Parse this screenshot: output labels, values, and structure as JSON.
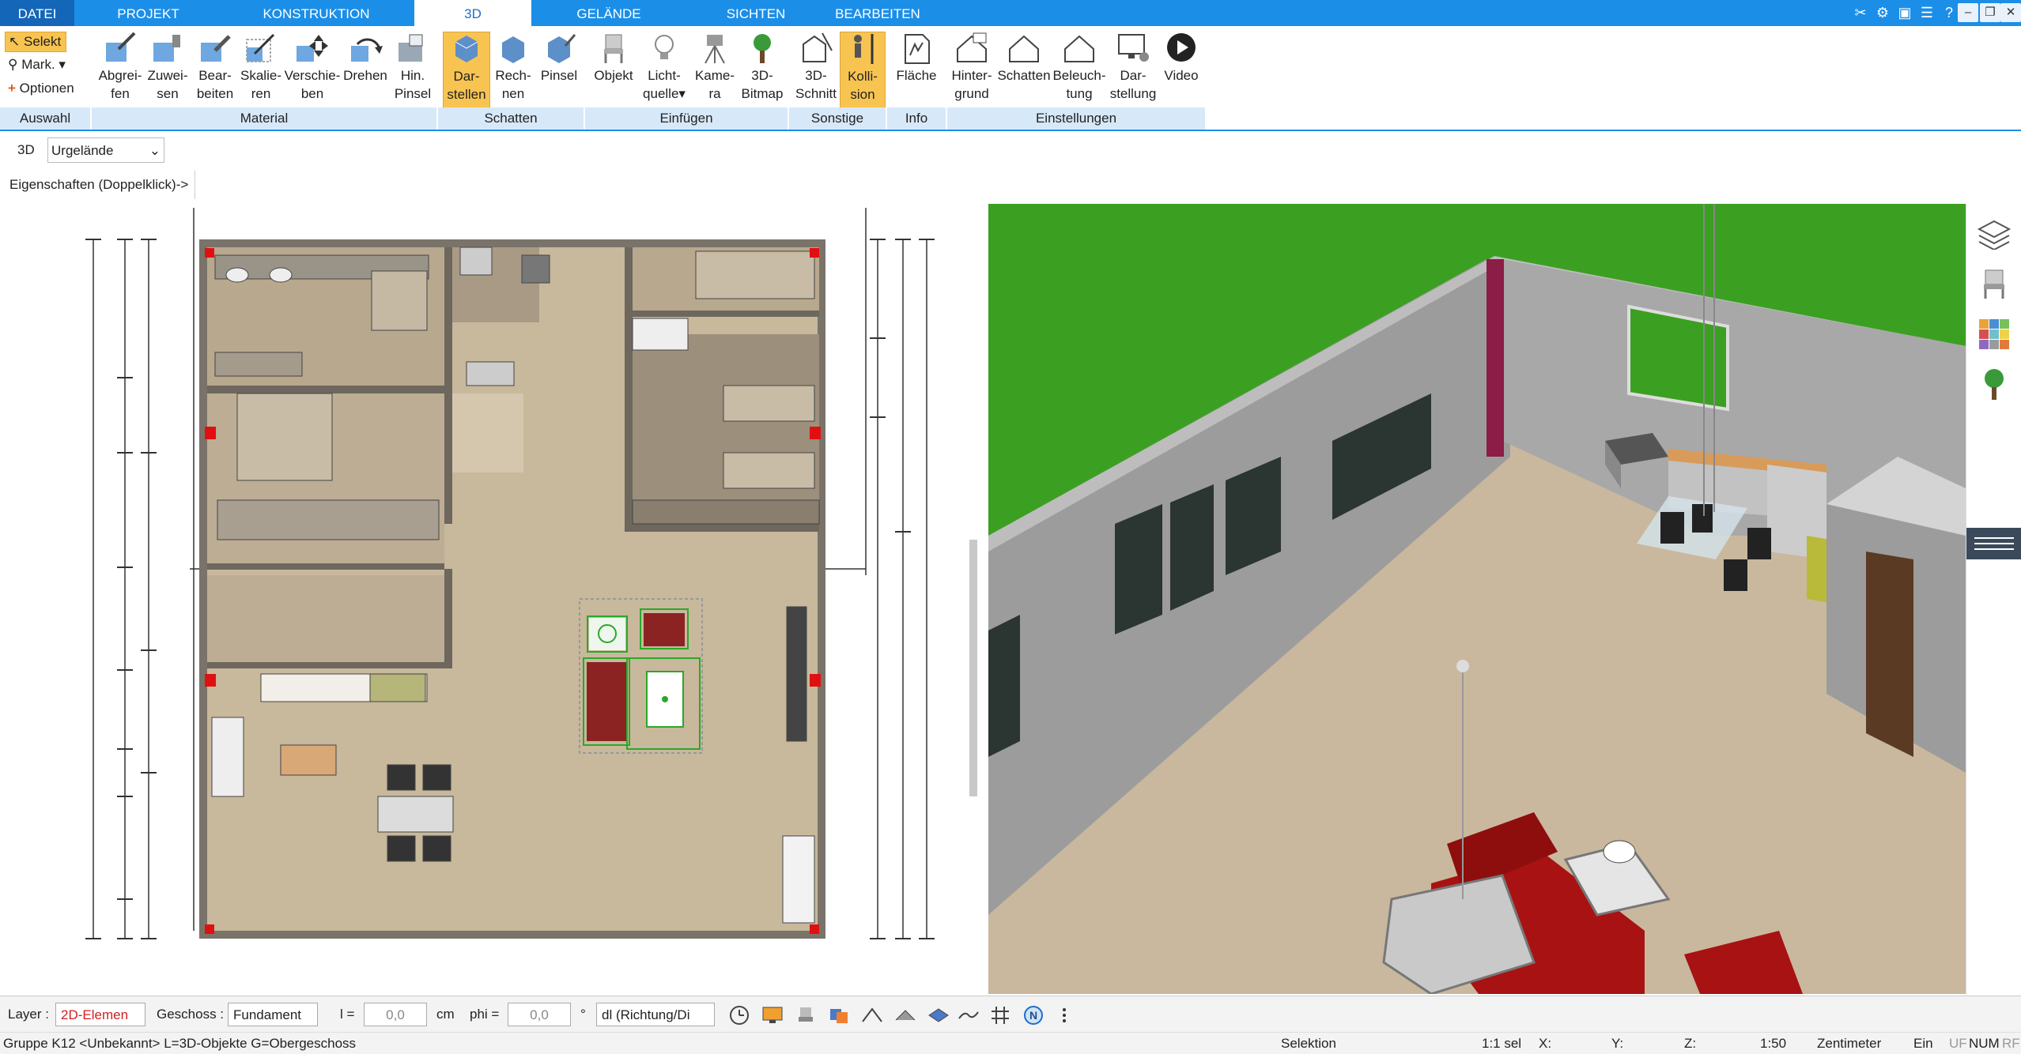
{
  "tabs": [
    {
      "label": "DATEI"
    },
    {
      "label": "PROJEKT"
    },
    {
      "label": "KONSTRUKTION"
    },
    {
      "label": "3D"
    },
    {
      "label": "GELÄNDE"
    },
    {
      "label": "SICHTEN"
    },
    {
      "label": "BEARBEITEN"
    }
  ],
  "ribbon": {
    "auswahl": {
      "selekt": "Selekt",
      "mark": "Mark.",
      "optionen": "Optionen",
      "group": "Auswahl"
    },
    "material": {
      "group": "Material",
      "buttons": [
        {
          "l1": "Abgrei-",
          "l2": "fen"
        },
        {
          "l1": "Zuwei-",
          "l2": "sen"
        },
        {
          "l1": "Bear-",
          "l2": "beiten"
        },
        {
          "l1": "Skalie-",
          "l2": "ren"
        },
        {
          "l1": "Verschie-",
          "l2": "ben"
        },
        {
          "l1": "Drehen",
          "l2": ""
        },
        {
          "l1": "Hin.",
          "l2": "Pinsel"
        }
      ]
    },
    "schatten": {
      "group": "Schatten",
      "buttons": [
        {
          "l1": "Dar-",
          "l2": "stellen"
        },
        {
          "l1": "Rech-",
          "l2": "nen"
        },
        {
          "l1": "Pinsel",
          "l2": ""
        }
      ]
    },
    "einfuegen": {
      "group": "Einfügen",
      "buttons": [
        {
          "l1": "Objekt",
          "l2": ""
        },
        {
          "l1": "Licht-",
          "l2": "quelle"
        },
        {
          "l1": "Kame-",
          "l2": "ra"
        },
        {
          "l1": "3D-",
          "l2": "Bitmap"
        }
      ]
    },
    "sonstige": {
      "group": "Sonstige",
      "buttons": [
        {
          "l1": "3D-",
          "l2": "Schnitt"
        },
        {
          "l1": "Kolli-",
          "l2": "sion"
        }
      ]
    },
    "info": {
      "group": "Info",
      "buttons": [
        {
          "l1": "Fläche",
          "l2": ""
        }
      ]
    },
    "einstellungen": {
      "group": "Einstellungen",
      "buttons": [
        {
          "l1": "Hinter-",
          "l2": "grund"
        },
        {
          "l1": "Schatten",
          "l2": ""
        },
        {
          "l1": "Beleuch-",
          "l2": "tung"
        },
        {
          "l1": "Dar-",
          "l2": "stellung"
        },
        {
          "l1": "Video",
          "l2": ""
        }
      ]
    }
  },
  "view_selector": {
    "prefix": "3D",
    "value": "Urgelände"
  },
  "properties_label": "Eigenschaften (Doppelklick)->",
  "bottom": {
    "layer_label": "Layer :",
    "layer_value": "2D-Elemen",
    "geschoss_label": "Geschoss :",
    "geschoss_value": "Fundament",
    "l_label": "l =",
    "l_value": "0,0",
    "l_unit": "cm",
    "phi_label": "phi =",
    "phi_value": "0,0",
    "phi_unit": "°",
    "dl_value": "dl (Richtung/Di"
  },
  "status": {
    "left": "Gruppe K12 <Unbekannt> L=3D-Objekte G=Obergeschoss",
    "mode": "Selektion",
    "sel": "1:1 sel",
    "x": "X:",
    "y": "Y:",
    "z": "Z:",
    "scale": "1:50",
    "unit": "Zentimeter",
    "ein": "Ein",
    "uf": "UF",
    "num": "NUM",
    "rf": "RF"
  },
  "colors": {
    "accent": "#1b8ee8",
    "tab_dark": "#1466b8",
    "selected": "#f7c451",
    "group_bg": "#d7e8f8",
    "sky": "#3fa524",
    "floor": "#c9b69a"
  }
}
